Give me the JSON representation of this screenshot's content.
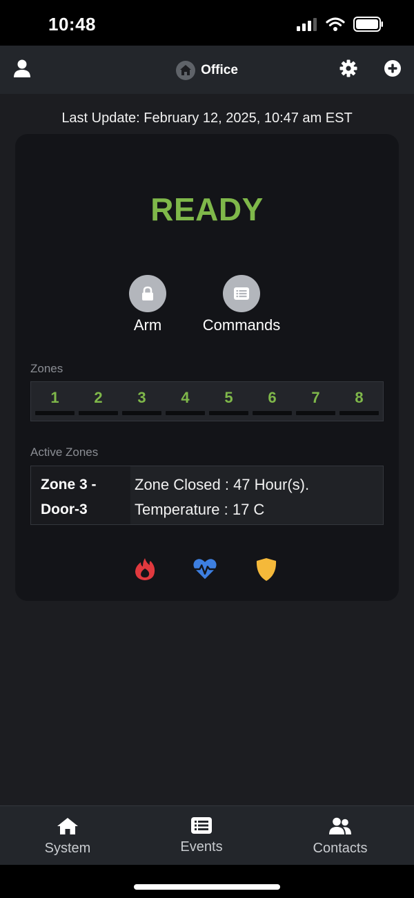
{
  "status_bar": {
    "time": "10:48",
    "icons": [
      "signal-icon",
      "wifi-icon",
      "battery-icon"
    ]
  },
  "nav": {
    "title": "Office",
    "icons": [
      "user-icon",
      "home-icon",
      "gear-icon",
      "plus-circle-icon"
    ]
  },
  "last_update": "Last Update: February 12, 2025, 10:47 am EST",
  "panel": {
    "status": "READY",
    "status_color": "#7fb84a",
    "actions": [
      {
        "label": "Arm",
        "icon": "lock-icon"
      },
      {
        "label": "Commands",
        "icon": "list-icon"
      }
    ]
  },
  "zones": {
    "label": "Zones",
    "items": [
      "1",
      "2",
      "3",
      "4",
      "5",
      "6",
      "7",
      "8"
    ]
  },
  "active_zones": {
    "label": "Active Zones",
    "name_line1": "Zone 3 -",
    "name_line2": "Door-3",
    "detail_line1": "Zone Closed : 47 Hour(s).",
    "detail_line2": "Temperature : 17 C"
  },
  "status_indicators": [
    {
      "icon": "fire-icon",
      "color": "#e0393e"
    },
    {
      "icon": "heart-pulse-icon",
      "color": "#3d7fe0"
    },
    {
      "icon": "shield-icon",
      "color": "#f5b93a"
    }
  ],
  "tabs": [
    {
      "label": "System",
      "icon": "home-icon"
    },
    {
      "label": "Events",
      "icon": "list-icon"
    },
    {
      "label": "Contacts",
      "icon": "users-icon"
    }
  ]
}
